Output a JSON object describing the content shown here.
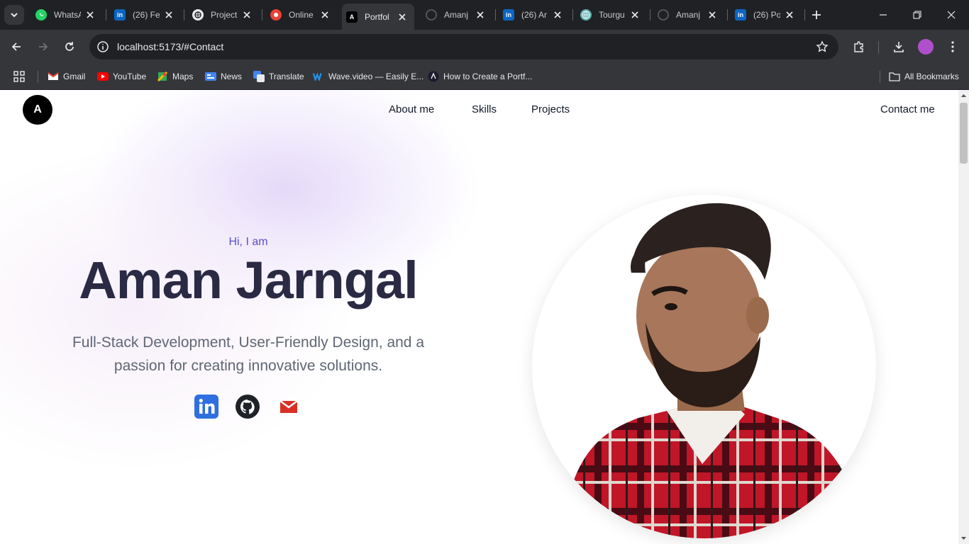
{
  "browser": {
    "tabs": [
      {
        "title": "WhatsA",
        "icon": "whatsapp-icon",
        "color": "#25d366"
      },
      {
        "title": "(26) Fe",
        "icon": "linkedin-icon",
        "color": "#0a66c2"
      },
      {
        "title": "Project",
        "icon": "chatgpt-icon",
        "color": "#e8eaed"
      },
      {
        "title": "Online",
        "icon": "record-icon",
        "color": "#ea4335"
      },
      {
        "title": "Portfol",
        "icon": "portfolio-logo-icon",
        "color": "#000000"
      },
      {
        "title": "Amanj",
        "icon": "github-icon",
        "color": "#1f2328"
      },
      {
        "title": "(26) Ar",
        "icon": "linkedin-icon",
        "color": "#0a66c2"
      },
      {
        "title": "Tourgu",
        "icon": "globe-icon",
        "color": "#5fb3b3"
      },
      {
        "title": "Amanj",
        "icon": "github-icon",
        "color": "#1f2328"
      },
      {
        "title": "(26) Po",
        "icon": "linkedin-icon",
        "color": "#0a66c2"
      }
    ],
    "active_tab_index": 4,
    "url": "localhost:5173/#Contact",
    "bookmarks": [
      {
        "label": "Gmail",
        "icon": "gmail-icon"
      },
      {
        "label": "YouTube",
        "icon": "youtube-icon"
      },
      {
        "label": "Maps",
        "icon": "maps-icon"
      },
      {
        "label": "News",
        "icon": "news-icon"
      },
      {
        "label": "Translate",
        "icon": "translate-icon"
      },
      {
        "label": "Wave.video — Easily E...",
        "icon": "wave-icon"
      },
      {
        "label": "How to Create a Portf...",
        "icon": "article-icon"
      }
    ],
    "all_bookmarks_label": "All Bookmarks"
  },
  "site": {
    "logo_text": "A",
    "nav": {
      "about": "About me",
      "skills": "Skills",
      "projects": "Projects",
      "contact": "Contact me"
    },
    "hero": {
      "greeting": "Hi, I am",
      "name": "Aman Jarngal",
      "tagline": "Full-Stack Development, User-Friendly Design, and a passion for creating innovative solutions."
    },
    "social": [
      "linkedin-icon",
      "github-icon",
      "gmail-icon"
    ],
    "accent_color": "#5b4fc9"
  }
}
